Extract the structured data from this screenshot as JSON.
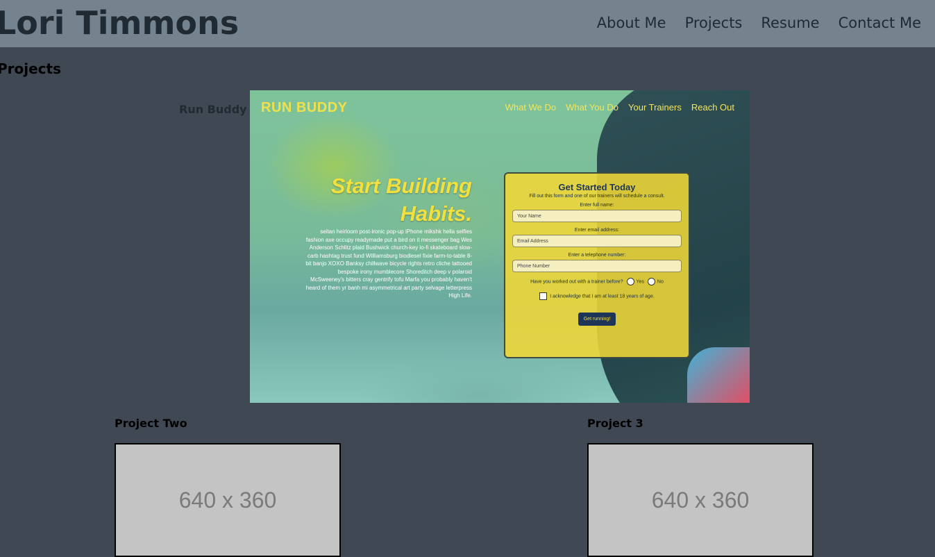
{
  "header": {
    "title": "Lori Timmons",
    "nav": [
      "About Me",
      "Projects",
      "Resume",
      "Contact Me"
    ]
  },
  "section": {
    "title": "Projects"
  },
  "projects": [
    {
      "label": "Run Buddy",
      "screenshot": {
        "logo": "RUN BUDDY",
        "nav": [
          "What We Do",
          "What You Do",
          "Your Trainers",
          "Reach Out"
        ],
        "hero_line1": "Start Building",
        "hero_line2": "Habits.",
        "body": "seitan heirloom post-ironic pop-up iPhone mikshk hella selfies fashion axe occupy readymade put a bird on it messenger bag Wes Anderson Schlitz plaid Bushwick church-key lo-fi skateboard slow-carb hashtag trust fund Williamsburg biodiesel fixie farm-to-table 8-bit banjo XOXO Banksy chillwave bicycle rights retro cliche tattooed bespoke irony mumblecore Shoreditch deep v polaroid McSweeney's bitters cray gentrify tofu Marfa you probably haven't heard of them yr banh mi asymmetrical art party selvage letterpress High Life.",
        "form": {
          "title": "Get Started Today",
          "subtitle": "Fill out this form and one of our trainers will schedule a consult.",
          "name_label": "Enter full name:",
          "name_placeholder": "Your Name",
          "email_label": "Enter email address:",
          "email_placeholder": "Email Address",
          "phone_label": "Enter a telephone number:",
          "phone_placeholder": "Phone Number",
          "question": "Have you worked out with a trainer before?",
          "yes": "Yes",
          "no": "No",
          "ack": "I acknowledge that I am at least 18 years of age.",
          "button": "Get running!"
        }
      }
    },
    {
      "label": "Project Two",
      "placeholder": "640 x 360"
    },
    {
      "label": "Project 3",
      "placeholder": "640 x 360"
    }
  ]
}
